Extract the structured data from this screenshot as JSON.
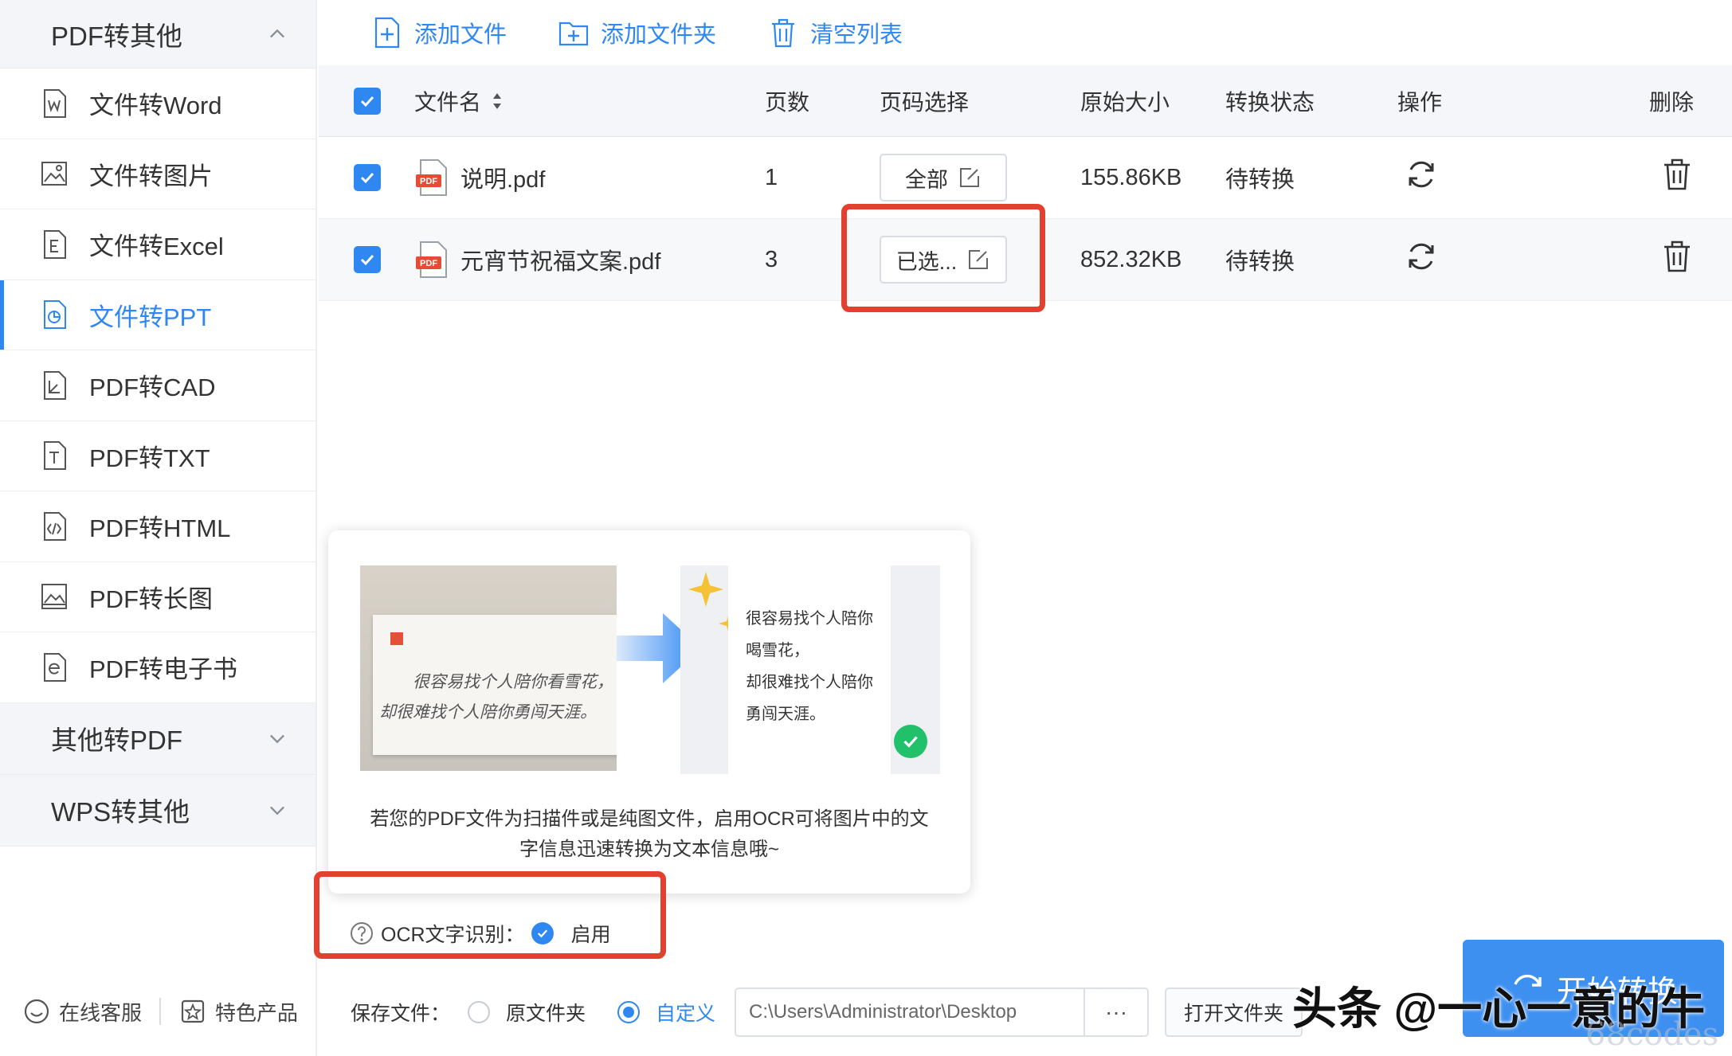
{
  "sidebar": {
    "groups": [
      {
        "label": "PDF转其他",
        "expanded": true
      },
      {
        "label": "其他转PDF",
        "expanded": false
      },
      {
        "label": "WPS转其他",
        "expanded": false
      }
    ],
    "items": [
      {
        "label": "文件转Word",
        "icon": "word-file-icon"
      },
      {
        "label": "文件转图片",
        "icon": "image-file-icon"
      },
      {
        "label": "文件转Excel",
        "icon": "excel-file-icon"
      },
      {
        "label": "文件转PPT",
        "icon": "ppt-file-icon",
        "active": true
      },
      {
        "label": "PDF转CAD",
        "icon": "cad-file-icon"
      },
      {
        "label": "PDF转TXT",
        "icon": "txt-file-icon"
      },
      {
        "label": "PDF转HTML",
        "icon": "html-file-icon"
      },
      {
        "label": "PDF转长图",
        "icon": "long-image-icon"
      },
      {
        "label": "PDF转电子书",
        "icon": "ebook-file-icon"
      }
    ],
    "footer": {
      "service": "在线客服",
      "products": "特色产品"
    }
  },
  "toolbar": {
    "add_file": "添加文件",
    "add_folder": "添加文件夹",
    "clear_list": "清空列表"
  },
  "table": {
    "headers": {
      "name": "文件名",
      "pages": "页数",
      "range": "页码选择",
      "size": "原始大小",
      "status": "转换状态",
      "op": "操作",
      "delete": "删除"
    },
    "rows": [
      {
        "name": "说明.pdf",
        "pages": "1",
        "range": "全部",
        "size": "155.86KB",
        "status": "待转换"
      },
      {
        "name": "元宵节祝福文案.pdf",
        "pages": "3",
        "range": "已选...",
        "size": "852.32KB",
        "status": "待转换"
      }
    ]
  },
  "popup": {
    "handwriting_line1": "很容易找个人陪你看雪花，",
    "handwriting_line2": "却很难找个人陪你勇闯天涯。",
    "ocr_lines": [
      "很容易找个人陪你",
      "喝雪花，",
      "却很难找个人陪你",
      "勇闯天涯。"
    ],
    "description_line1": "若您的PDF文件为扫描件或是纯图文件，启用OCR可将图片中的文",
    "description_line2": "字信息迅速转换为文本信息哦~"
  },
  "ocr": {
    "label": "OCR文字识别：",
    "value": "启用"
  },
  "save": {
    "label": "保存文件：",
    "option_original": "原文件夹",
    "option_custom": "自定义",
    "path": "C:\\Users\\Administrator\\Desktop",
    "more": "···",
    "open_folder": "打开文件夹"
  },
  "convert": {
    "label": "开始转换"
  },
  "watermark": {
    "text": "头条 @一心一意的牛",
    "faint": "68codes"
  },
  "colors": {
    "accent": "#2f88f2",
    "highlight": "#e3412f",
    "success": "#21c16b"
  }
}
